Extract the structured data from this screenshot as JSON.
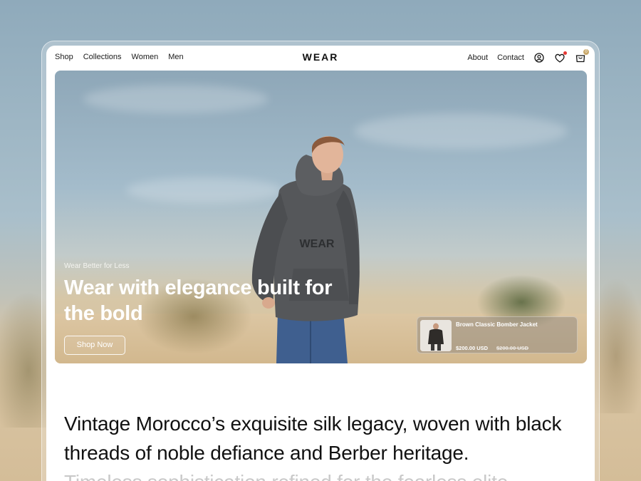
{
  "nav": {
    "links": [
      "Shop",
      "Collections",
      "Women",
      "Men"
    ],
    "brand": "WEAR",
    "right_links": [
      "About",
      "Contact"
    ],
    "icons": [
      "user-icon",
      "heart-icon",
      "cart-icon"
    ],
    "cart_count": "0"
  },
  "hero": {
    "kicker": "Wear Better for Less",
    "title": "Wear with elegance built for the bold",
    "cta": "Shop Now",
    "hoodie_print": "WEAR",
    "product": {
      "name": "Brown Classic Bomber Jacket",
      "price": "$200.00 USD",
      "compare_price": "$200.00 USD"
    }
  },
  "statement": {
    "text": "Vintage Morocco’s exquisite silk legacy, woven with black threads of noble defiance and Berber heritage.",
    "faded_text": "Timeless sophistication refined for the fearless elite"
  },
  "colors": {
    "accent": "#c9a86a",
    "notification": "#e53935",
    "text": "#111111"
  }
}
